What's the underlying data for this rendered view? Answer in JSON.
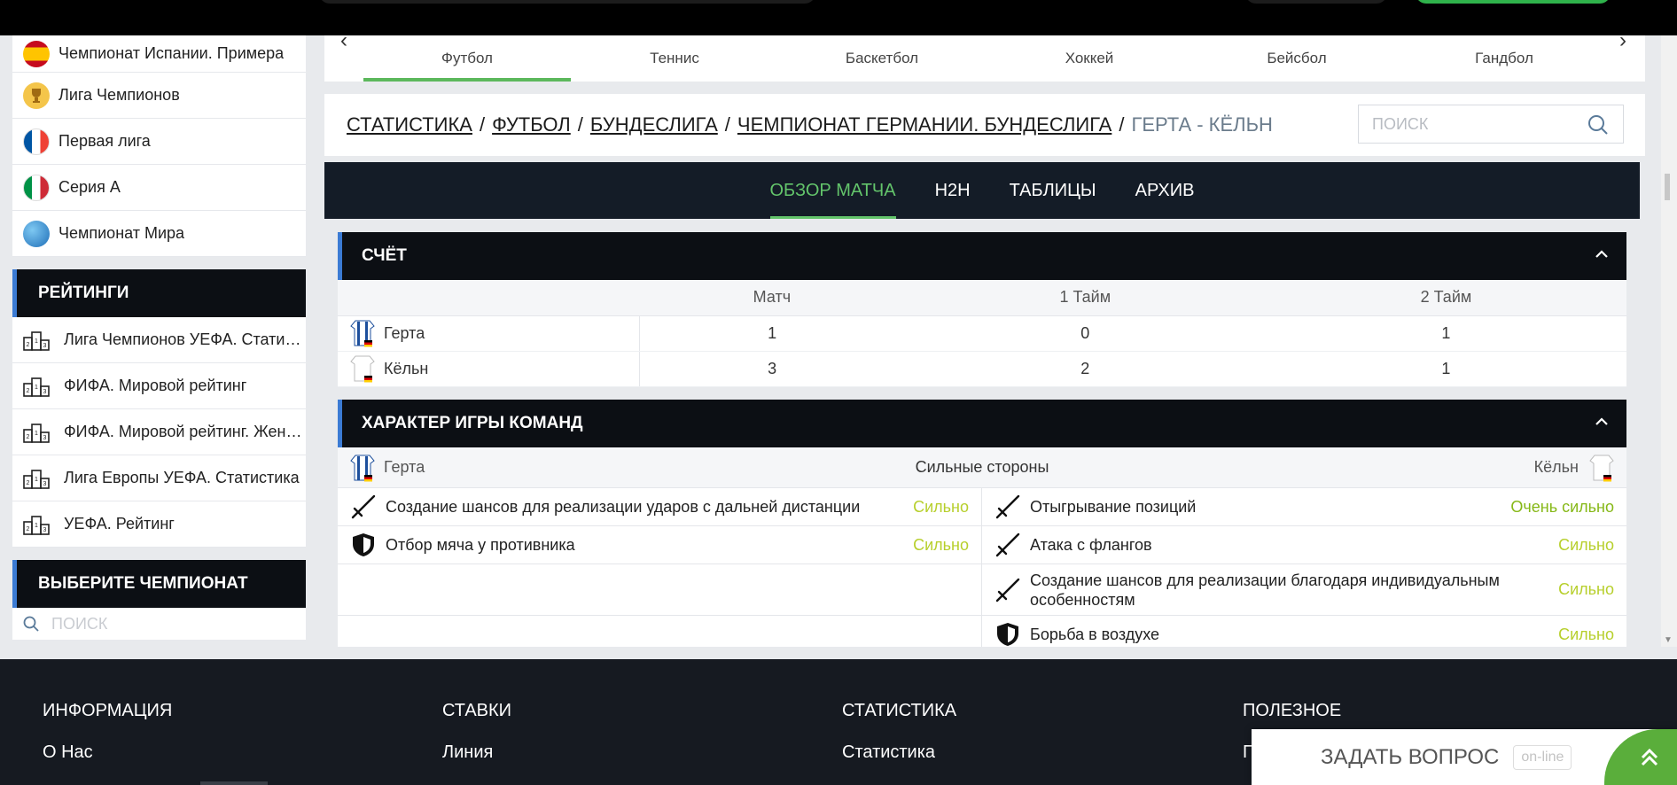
{
  "sidebar": {
    "leagues": [
      {
        "label": "Чемпионат Испании. Примера",
        "icon": "spain-flag-icon"
      },
      {
        "label": "Лига Чемпионов",
        "icon": "trophy-icon"
      },
      {
        "label": "Первая лига",
        "icon": "france-flag-icon"
      },
      {
        "label": "Серия А",
        "icon": "italy-flag-icon"
      },
      {
        "label": "Чемпионат Мира",
        "icon": "globe-icon"
      }
    ],
    "ratings_title": "РЕЙТИНГИ",
    "ratings": [
      {
        "label": "Лига Чемпионов УЕФА. Статистика"
      },
      {
        "label": "ФИФА. Мировой рейтинг"
      },
      {
        "label": "ФИФА. Мировой рейтинг. Женщины"
      },
      {
        "label": "Лига Европы УЕФА. Статистика"
      },
      {
        "label": "УЕФА. Рейтинг"
      }
    ],
    "choose_title": "ВЫБЕРИТЕ ЧЕМПИОНАТ",
    "search_placeholder": "ПОИСК"
  },
  "sports_tabs": [
    "Футбол",
    "Теннис",
    "Баскетбол",
    "Хоккей",
    "Бейсбол",
    "Гандбол"
  ],
  "active_sport": "Футбол",
  "breadcrumb": {
    "items": [
      "СТАТИСТИКА",
      "ФУТБОЛ",
      "БУНДЕСЛИГА",
      "ЧЕМПИОНАТ ГЕРМАНИИ. БУНДЕСЛИГА"
    ],
    "separator": "/",
    "current": "ГЕРТА - КЁЛЬН",
    "search_placeholder": "ПОИСК"
  },
  "match_nav": {
    "items": [
      "ОБЗОР МАТЧА",
      "H2H",
      "ТАБЛИЦЫ",
      "АРХИВ"
    ],
    "active": "ОБЗОР МАТЧА"
  },
  "score": {
    "title": "СЧЁТ",
    "columns": [
      "Матч",
      "1 Тайм",
      "2 Тайм"
    ],
    "rows": [
      {
        "team": "Герта",
        "values": [
          "1",
          "0",
          "1"
        ]
      },
      {
        "team": "Кёльн",
        "values": [
          "3",
          "2",
          "1"
        ]
      }
    ]
  },
  "style": {
    "title": "ХАРАКТЕР ИГРЫ КОМАНД",
    "left_team": "Герта",
    "middle_label": "Сильные стороны",
    "right_team": "Кёльн",
    "left": [
      {
        "icon": "attack-swords-icon",
        "text": "Создание шансов для реализации ударов с дальней дистанции",
        "level": "Сильно"
      },
      {
        "icon": "defense-shield-icon",
        "text": "Отбор мяча у противника",
        "level": "Сильно"
      }
    ],
    "right": [
      {
        "icon": "attack-swords-icon",
        "text": "Отыгрывание позиций",
        "level": "Очень сильно"
      },
      {
        "icon": "attack-swords-icon",
        "text": "Атака с флангов",
        "level": "Сильно"
      },
      {
        "icon": "attack-swords-icon",
        "text": "Создание шансов для реализации благодаря индивидуальным особенностям",
        "level": "Сильно"
      },
      {
        "icon": "defense-shield-icon",
        "text": "Борьба в воздухе",
        "level": "Сильно"
      }
    ]
  },
  "footer": {
    "columns": [
      {
        "title": "ИНФОРМАЦИЯ",
        "link": "О Нас"
      },
      {
        "title": "СТАВКИ",
        "link": "Линия"
      },
      {
        "title": "СТАТИСТИКА",
        "link": "Статистика"
      },
      {
        "title": "ПОЛЕЗНОЕ",
        "link": "П"
      }
    ]
  },
  "ask_widget": {
    "label": "ЗАДАТЬ ВОПРОС",
    "badge": "on-line"
  },
  "colors": {
    "accent_green": "#5cb85c",
    "dark_header": "#0c0f14",
    "level_strong": "#b7cf2c",
    "level_very_strong": "#86b817"
  }
}
